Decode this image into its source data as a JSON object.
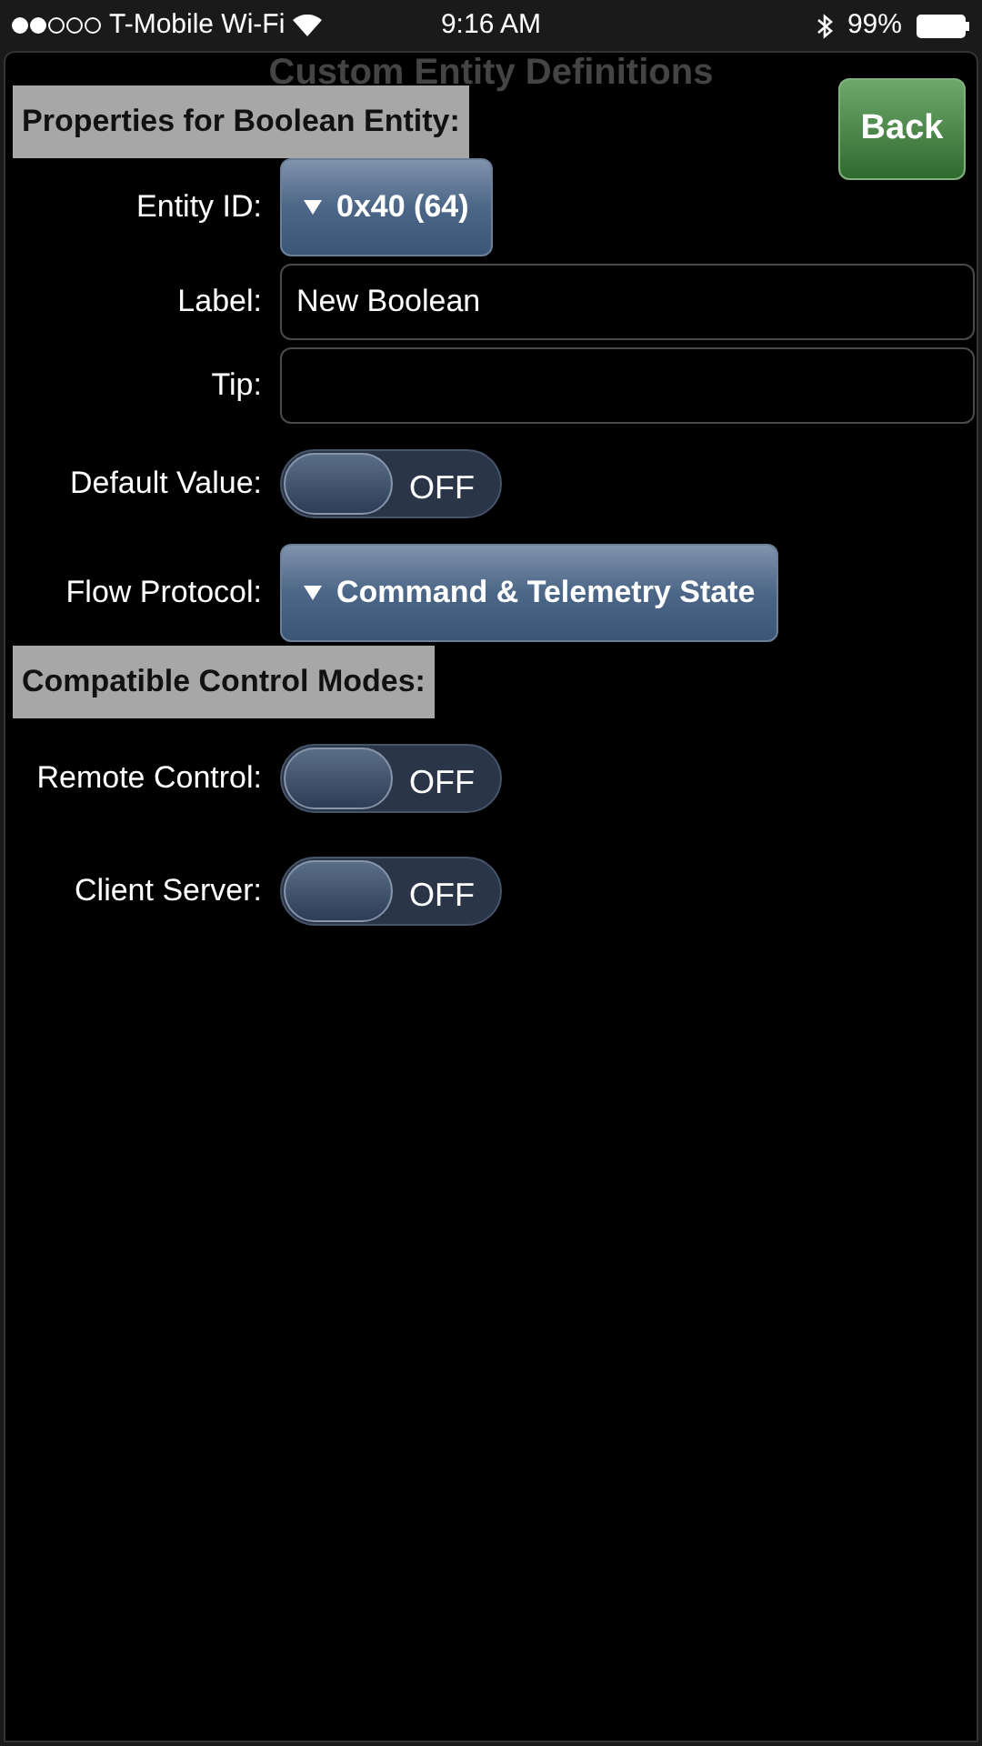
{
  "status_bar": {
    "carrier": "T-Mobile Wi-Fi",
    "time": "9:16 AM",
    "battery": "99%"
  },
  "screen_title": "Custom Entity Definitions",
  "back_button": "Back",
  "sections": [
    {
      "heading": "Properties for Boolean Entity:",
      "fields": [
        {
          "kind": "dropdown",
          "label": "Entity ID:",
          "value": "0x40 (64)"
        },
        {
          "kind": "text",
          "label": "Label:",
          "value": "New Boolean"
        },
        {
          "kind": "text",
          "label": "Tip:"
        },
        {
          "kind": "toggle",
          "label": "Default Value:",
          "on": false,
          "state_text": "OFF"
        },
        {
          "kind": "dropdown",
          "label": "Flow Protocol:",
          "value": "Command & Telemetry State"
        }
      ]
    },
    {
      "heading": "Compatible Control Modes:",
      "fields": [
        {
          "kind": "toggle",
          "label": "Remote Control:",
          "on": false,
          "state_text": "OFF"
        },
        {
          "kind": "toggle",
          "label": "Client Server:",
          "on": false,
          "state_text": "OFF"
        }
      ]
    }
  ]
}
